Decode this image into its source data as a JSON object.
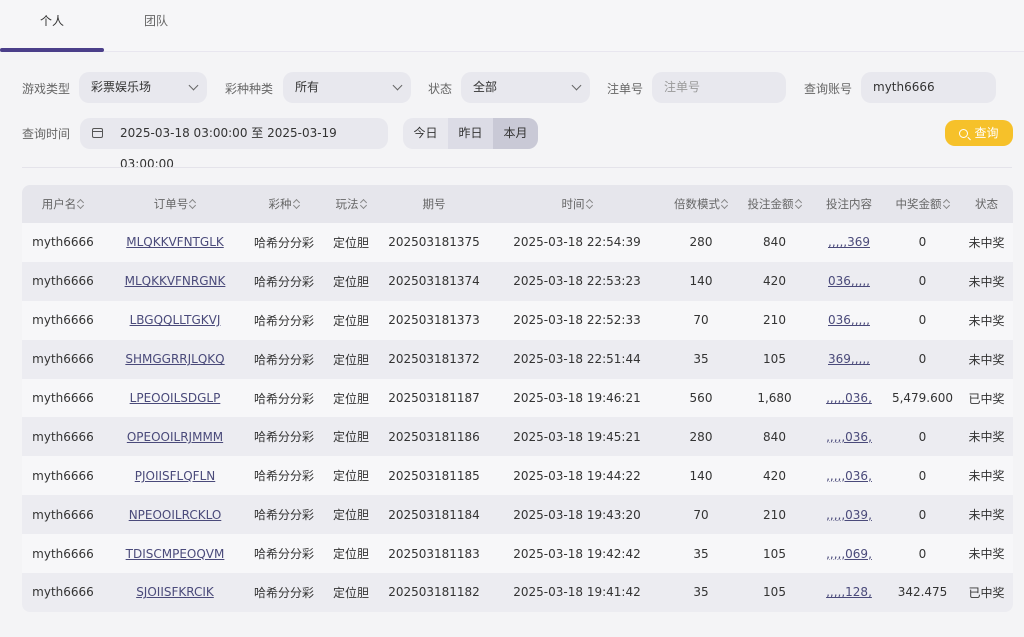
{
  "tabs": [
    {
      "label": "个人",
      "active": true
    },
    {
      "label": "团队",
      "active": false
    }
  ],
  "filters": {
    "game_type_label": "游戏类型",
    "game_type_value": "彩票娱乐场",
    "lottery_kind_label": "彩种种类",
    "lottery_kind_value": "所有",
    "status_label": "状态",
    "status_value": "全部",
    "order_no_label": "注单号",
    "order_no_placeholder": "注单号",
    "account_label": "查询账号",
    "account_value": "myth6666",
    "time_label": "查询时间",
    "time_range": "2025-03-18 03:00:00 至 2025-03-19 03:00:00",
    "range_buttons": [
      "今日",
      "昨日",
      "本月"
    ],
    "search_label": "查询"
  },
  "colors": {
    "accent": "#4b3f8a",
    "search_button": "#f6c12a"
  },
  "table": {
    "headers": [
      "用户名",
      "订单号",
      "彩种",
      "玩法",
      "期号",
      "时间",
      "倍数模式",
      "投注金额",
      "投注内容",
      "中奖金额",
      "状态"
    ],
    "rows": [
      [
        "myth6666",
        "MLQKKVFNTGLK",
        "哈希分分彩",
        "定位胆",
        "202503181375",
        "2025-03-18 22:54:39",
        "280",
        "840",
        ",,,,,369",
        "0",
        "未中奖"
      ],
      [
        "myth6666",
        "MLQKKVFNRGNK",
        "哈希分分彩",
        "定位胆",
        "202503181374",
        "2025-03-18 22:53:23",
        "140",
        "420",
        "036,,,,,",
        "0",
        "未中奖"
      ],
      [
        "myth6666",
        "LBGQQLLTGKVJ",
        "哈希分分彩",
        "定位胆",
        "202503181373",
        "2025-03-18 22:52:33",
        "70",
        "210",
        "036,,,,,",
        "0",
        "未中奖"
      ],
      [
        "myth6666",
        "SHMGGRRJLQKQ",
        "哈希分分彩",
        "定位胆",
        "202503181372",
        "2025-03-18 22:51:44",
        "35",
        "105",
        "369,,,,,",
        "0",
        "未中奖"
      ],
      [
        "myth6666",
        "LPEOOILSDGLP",
        "哈希分分彩",
        "定位胆",
        "202503181187",
        "2025-03-18 19:46:21",
        "560",
        "1,680",
        ",,,,,036,",
        "5,479.600",
        "已中奖"
      ],
      [
        "myth6666",
        "OPEOOILRJMMM",
        "哈希分分彩",
        "定位胆",
        "202503181186",
        "2025-03-18 19:45:21",
        "280",
        "840",
        ",,,,,036,",
        "0",
        "未中奖"
      ],
      [
        "myth6666",
        "PJOIISFLQFLN",
        "哈希分分彩",
        "定位胆",
        "202503181185",
        "2025-03-18 19:44:22",
        "140",
        "420",
        ",,,,,036,",
        "0",
        "未中奖"
      ],
      [
        "myth6666",
        "NPEOOILRCKLO",
        "哈希分分彩",
        "定位胆",
        "202503181184",
        "2025-03-18 19:43:20",
        "70",
        "210",
        ",,,,,039,",
        "0",
        "未中奖"
      ],
      [
        "myth6666",
        "TDISCMPEOQVM",
        "哈希分分彩",
        "定位胆",
        "202503181183",
        "2025-03-18 19:42:42",
        "35",
        "105",
        ",,,,,069,",
        "0",
        "未中奖"
      ],
      [
        "myth6666",
        "SJOIISFKRCIK",
        "哈希分分彩",
        "定位胆",
        "202503181182",
        "2025-03-18 19:41:42",
        "35",
        "105",
        ",,,,,128,",
        "342.475",
        "已中奖"
      ]
    ]
  }
}
